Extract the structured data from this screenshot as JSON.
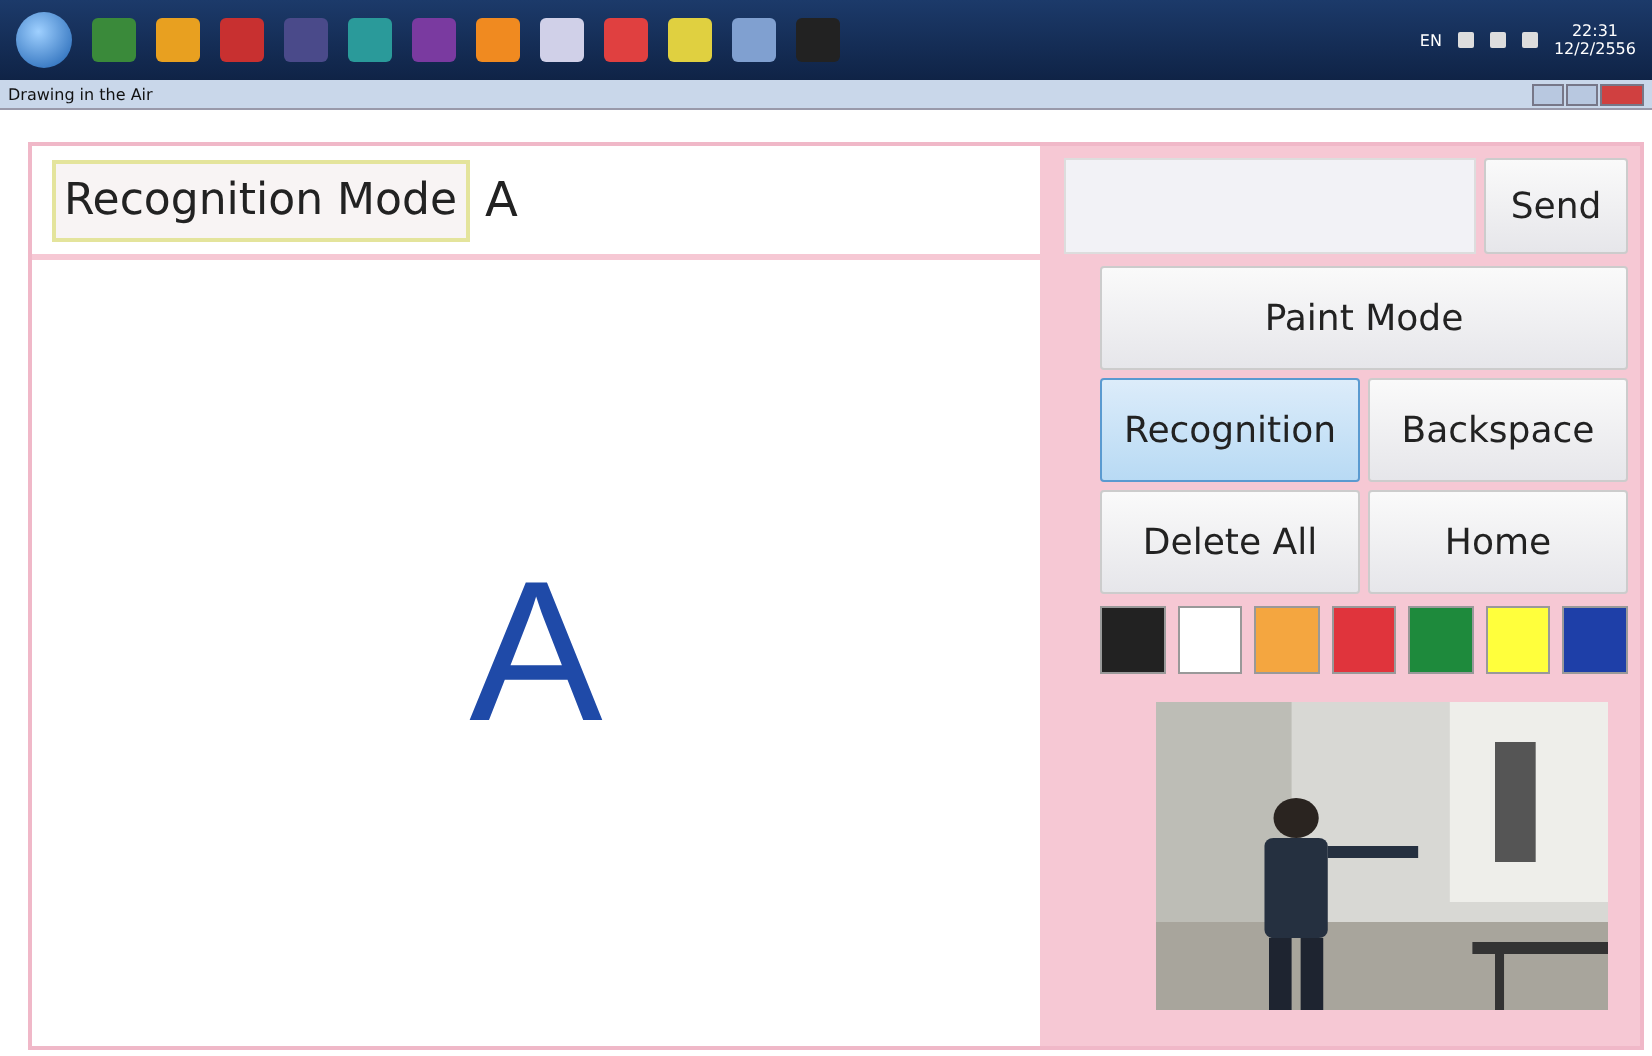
{
  "taskbar": {
    "language": "EN",
    "time": "22:31",
    "date": "12/2/2556"
  },
  "window": {
    "title": "Drawing in the Air"
  },
  "mode_label": "Recognition Mode",
  "recognized_text": "A",
  "canvas": {
    "letter": "A"
  },
  "send_button": "Send",
  "buttons": [
    {
      "label": "Paint Mode",
      "selected": false
    },
    {
      "label": "Recognition",
      "selected": true
    },
    {
      "label": "Backspace",
      "selected": false
    },
    {
      "label": "Delete All",
      "selected": false
    },
    {
      "label": "Home",
      "selected": false
    }
  ],
  "colors": [
    {
      "color": "#222222"
    },
    {
      "color": "#ffffff"
    },
    {
      "color": "#f4a640"
    },
    {
      "color": "#e0343c"
    },
    {
      "color": "#1e8a3c"
    },
    {
      "color": "#ffff3c"
    },
    {
      "color": "#1e3fa8"
    }
  ]
}
